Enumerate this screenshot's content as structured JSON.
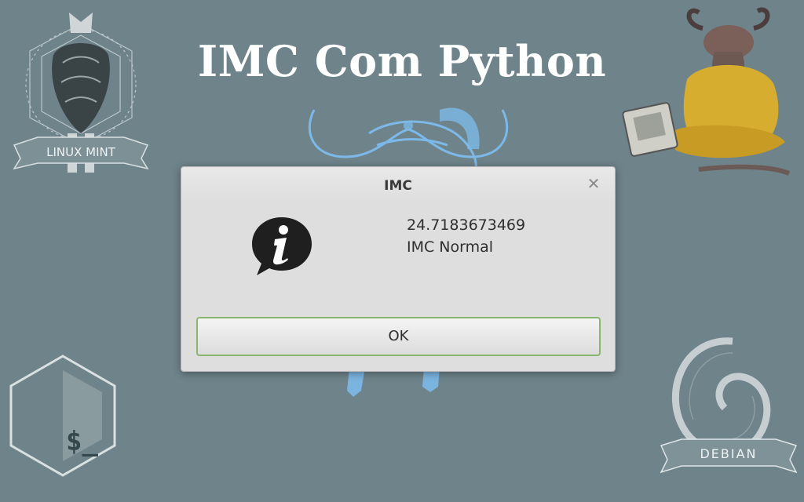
{
  "wallpaper": {
    "title": "IMC Com Python",
    "mint_banner": "LINUX MINT",
    "debian_banner": "DEBIAN",
    "bash_prompt": "$_"
  },
  "dialog": {
    "title": "IMC",
    "close_icon": "close-icon",
    "info_icon": "info-icon",
    "message_line1": "24.7183673469",
    "message_line2": "IMC Normal",
    "ok_label": "OK",
    "accent_color": "#8ab56f"
  }
}
